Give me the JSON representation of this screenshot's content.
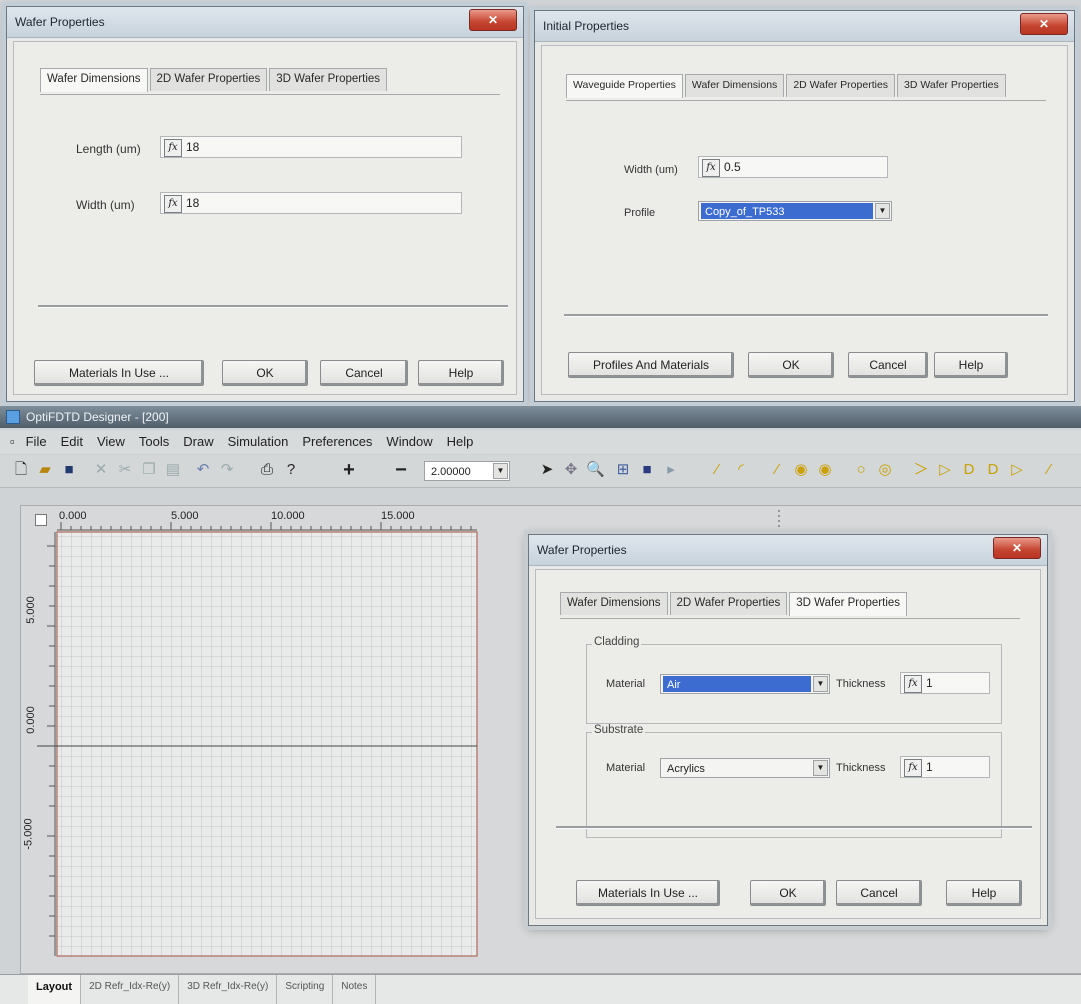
{
  "dialog1": {
    "title": "Wafer Properties",
    "tabs": [
      "Wafer Dimensions",
      "2D Wafer Properties",
      "3D Wafer Properties"
    ],
    "length_label": "Length (um)",
    "length_value": "18",
    "width_label": "Width (um)",
    "width_value": "18",
    "buttons": {
      "materials": "Materials In Use ...",
      "ok": "OK",
      "cancel": "Cancel",
      "help": "Help"
    }
  },
  "dialog2": {
    "title": "Initial Properties",
    "tabs": [
      "Waveguide Properties",
      "Wafer Dimensions",
      "2D Wafer Properties",
      "3D Wafer Properties"
    ],
    "width_label": "Width (um)",
    "width_value": "0.5",
    "profile_label": "Profile",
    "profile_value": "Copy_of_TP533",
    "buttons": {
      "profiles": "Profiles And Materials",
      "ok": "OK",
      "cancel": "Cancel",
      "help": "Help"
    }
  },
  "app": {
    "title": "OptiFDTD Designer - [200]",
    "menu": [
      "File",
      "Edit",
      "View",
      "Tools",
      "Draw",
      "Simulation",
      "Preferences",
      "Window",
      "Help"
    ],
    "zoom": "2.00000",
    "ruler_top": [
      "0.000",
      "5.000",
      "10.000",
      "15.000"
    ],
    "ruler_left": [
      "5.000",
      "0.000",
      "-5.000"
    ],
    "bottom_tabs": [
      "Layout",
      "2D Refr_Idx-Re(y)",
      "3D Refr_Idx-Re(y)",
      "Scripting",
      "Notes"
    ]
  },
  "dialog3": {
    "title": "Wafer Properties",
    "tabs": [
      "Wafer Dimensions",
      "2D Wafer Properties",
      "3D Wafer Properties"
    ],
    "cladding_label": "Cladding",
    "cladding_material_label": "Material",
    "cladding_material_value": "Air",
    "cladding_thickness_label": "Thickness",
    "cladding_thickness_value": "1",
    "substrate_label": "Substrate",
    "substrate_material_label": "Material",
    "substrate_material_value": "Acrylics",
    "substrate_thickness_label": "Thickness",
    "substrate_thickness_value": "1",
    "buttons": {
      "materials": "Materials In Use ...",
      "ok": "OK",
      "cancel": "Cancel",
      "help": "Help"
    }
  }
}
